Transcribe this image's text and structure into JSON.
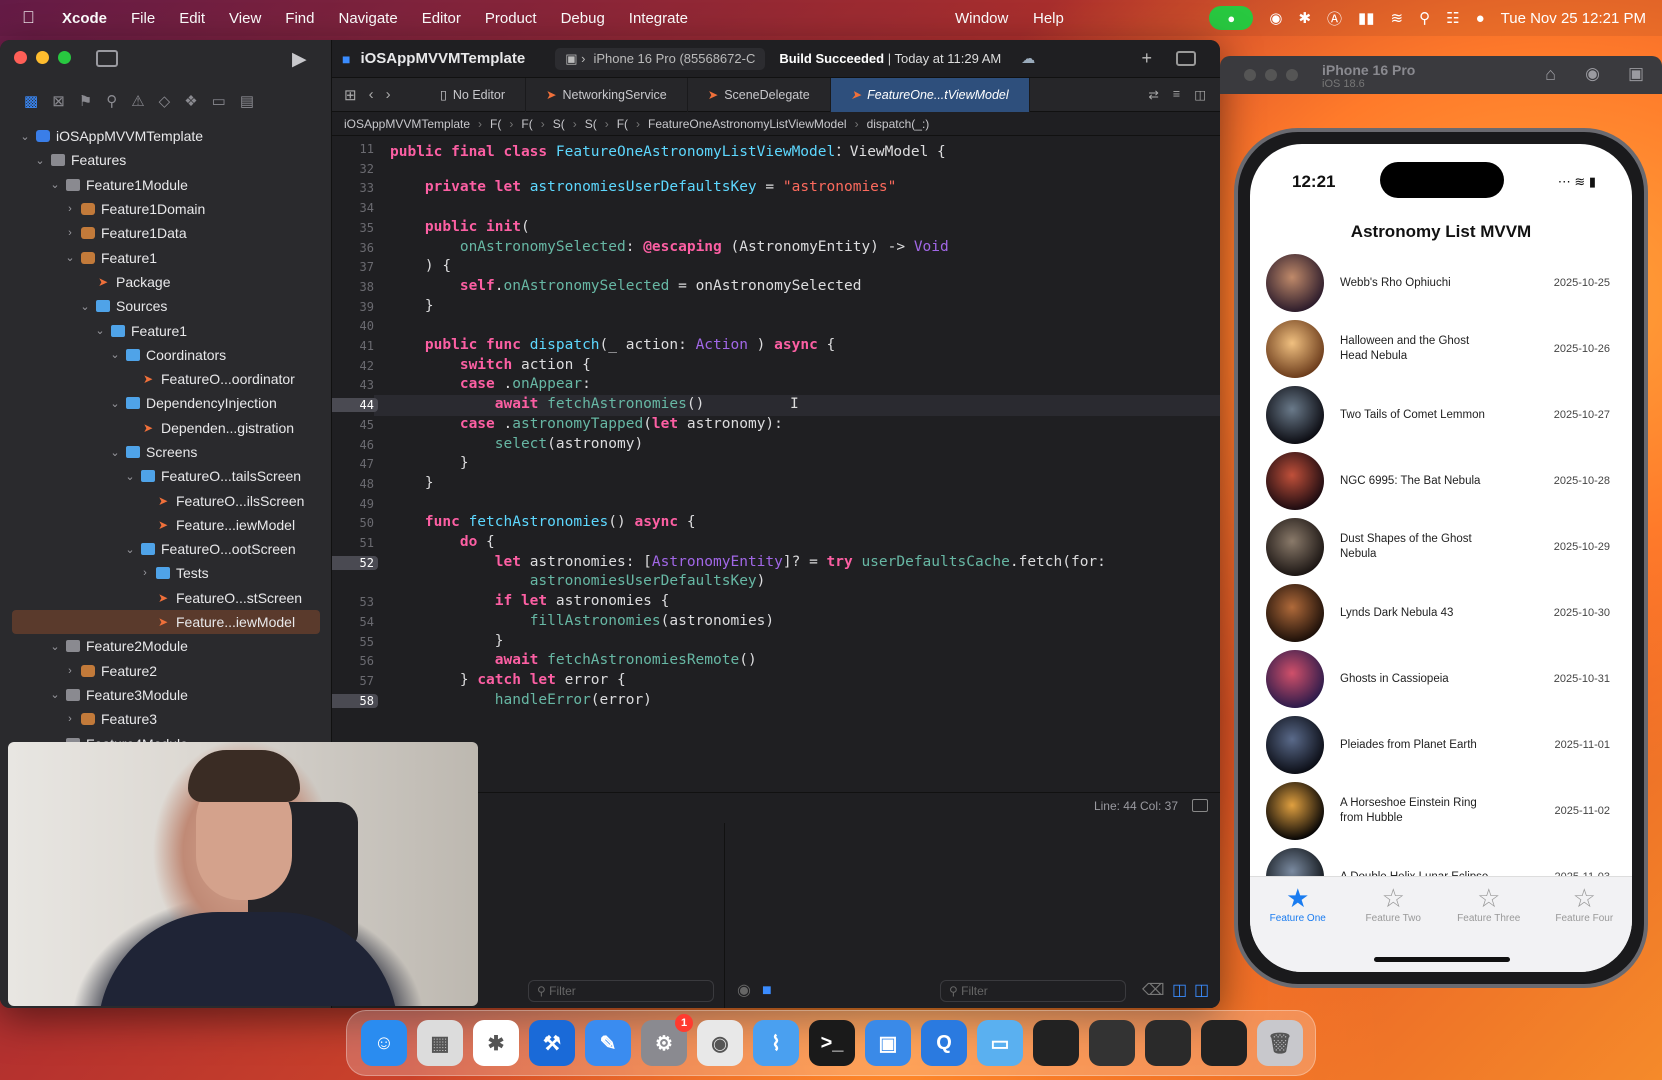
{
  "menubar": {
    "app": "Xcode",
    "items": [
      "File",
      "Edit",
      "View",
      "Find",
      "Navigate",
      "Editor",
      "Product",
      "Debug",
      "Integrate"
    ],
    "right_items": [
      "Window",
      "Help"
    ],
    "clock": "Tue Nov 25  12:21 PM"
  },
  "xcode": {
    "project": "iOSAppMVVMTemplate",
    "scheme_device": "iPhone 16 Pro (85568672-C",
    "build_status_bold": "Build Succeeded",
    "build_status_rest": "| Today at 11:29 AM",
    "tabs": [
      "No Editor",
      "NetworkingService",
      "SceneDelegate",
      "FeatureOne...tViewModel"
    ],
    "breadcrumb": [
      "iOSAppMVVMTemplate",
      "F(",
      "F(",
      "S(",
      "S(",
      "F(",
      "FeatureOneAstronomyListViewModel",
      "dispatch(_:)"
    ],
    "sticky_line": "11",
    "cursor_status": "Line: 44  Col: 37",
    "filter_placeholder": "Filter"
  },
  "navigator": {
    "rows": [
      {
        "label": "iOSAppMVVMTemplate",
        "indent": 0,
        "chev": "v",
        "icon": "proj"
      },
      {
        "label": "Features",
        "indent": 1,
        "chev": "v",
        "icon": "gfolder"
      },
      {
        "label": "Feature1Module",
        "indent": 2,
        "chev": "v",
        "icon": "gfolder"
      },
      {
        "label": "Feature1Domain",
        "indent": 3,
        "chev": ">",
        "icon": "pkg"
      },
      {
        "label": "Feature1Data",
        "indent": 3,
        "chev": ">",
        "icon": "pkg"
      },
      {
        "label": "Feature1",
        "indent": 3,
        "chev": "v",
        "icon": "pkg"
      },
      {
        "label": "Package",
        "indent": 4,
        "chev": "",
        "icon": "swift"
      },
      {
        "label": "Sources",
        "indent": 4,
        "chev": "v",
        "icon": "folder"
      },
      {
        "label": "Feature1",
        "indent": 5,
        "chev": "v",
        "icon": "folder"
      },
      {
        "label": "Coordinators",
        "indent": 6,
        "chev": "v",
        "icon": "folder"
      },
      {
        "label": "FeatureO...oordinator",
        "indent": 7,
        "chev": "",
        "icon": "swift"
      },
      {
        "label": "DependencyInjection",
        "indent": 6,
        "chev": "v",
        "icon": "folder"
      },
      {
        "label": "Dependen...gistration",
        "indent": 7,
        "chev": "",
        "icon": "swift"
      },
      {
        "label": "Screens",
        "indent": 6,
        "chev": "v",
        "icon": "folder"
      },
      {
        "label": "FeatureO...tailsScreen",
        "indent": 7,
        "chev": "v",
        "icon": "folder"
      },
      {
        "label": "FeatureO...ilsScreen",
        "indent": 8,
        "chev": "",
        "icon": "swift"
      },
      {
        "label": "Feature...iewModel",
        "indent": 8,
        "chev": "",
        "icon": "swift"
      },
      {
        "label": "FeatureO...ootScreen",
        "indent": 7,
        "chev": "v",
        "icon": "folder"
      },
      {
        "label": "Tests",
        "indent": 8,
        "chev": ">",
        "icon": "folder"
      },
      {
        "label": "FeatureO...stScreen",
        "indent": 8,
        "chev": "",
        "icon": "swift"
      },
      {
        "label": "Feature...iewModel",
        "indent": 8,
        "chev": "",
        "icon": "swift",
        "selected": true
      },
      {
        "label": "Feature2Module",
        "indent": 2,
        "chev": "v",
        "icon": "gfolder"
      },
      {
        "label": "Feature2",
        "indent": 3,
        "chev": ">",
        "icon": "pkg"
      },
      {
        "label": "Feature3Module",
        "indent": 2,
        "chev": "v",
        "icon": "gfolder"
      },
      {
        "label": "Feature3",
        "indent": 3,
        "chev": ">",
        "icon": "pkg"
      },
      {
        "label": "Feature4Module",
        "indent": 2,
        "chev": "v",
        "icon": "gfolder"
      }
    ]
  },
  "code": {
    "lines": [
      {
        "n": "11",
        "t": [
          [
            "kw",
            "public final class "
          ],
          [
            "ty",
            "FeatureOneAstronomyListViewModel"
          ],
          [
            "",
            "：ViewModel {"
          ]
        ]
      },
      {
        "n": "32",
        "t": []
      },
      {
        "n": "33",
        "t": [
          [
            "",
            "    "
          ],
          [
            "kw",
            "private let "
          ],
          [
            "ty",
            "astronomiesUserDefaultsKey"
          ],
          [
            "",
            " = "
          ],
          [
            "st",
            "\"astronomies\""
          ]
        ]
      },
      {
        "n": "34",
        "t": []
      },
      {
        "n": "35",
        "t": [
          [
            "",
            "    "
          ],
          [
            "kw",
            "public init"
          ],
          [
            "",
            "("
          ]
        ]
      },
      {
        "n": "36",
        "t": [
          [
            "",
            "        "
          ],
          [
            "fn",
            "onAstronomySelected"
          ],
          [
            "",
            ": "
          ],
          [
            "kw",
            "@escaping"
          ],
          [
            "",
            " (AstronomyEntity) -> "
          ],
          [
            "pl",
            "Void"
          ]
        ]
      },
      {
        "n": "37",
        "t": [
          [
            "",
            "    ) {"
          ]
        ]
      },
      {
        "n": "38",
        "t": [
          [
            "",
            "        "
          ],
          [
            "kw",
            "self"
          ],
          [
            "",
            "."
          ],
          [
            "fn",
            "onAstronomySelected"
          ],
          [
            "",
            " = onAstronomySelected"
          ]
        ]
      },
      {
        "n": "39",
        "t": [
          [
            "",
            "    }"
          ]
        ]
      },
      {
        "n": "40",
        "t": []
      },
      {
        "n": "41",
        "t": [
          [
            "",
            "    "
          ],
          [
            "kw",
            "public func "
          ],
          [
            "ty",
            "dispatch"
          ],
          [
            "",
            "(_ action: "
          ],
          [
            "pl",
            "Action"
          ],
          [
            "",
            " ) "
          ],
          [
            "kw",
            "async"
          ],
          [
            "",
            " {"
          ]
        ]
      },
      {
        "n": "42",
        "t": [
          [
            "",
            "        "
          ],
          [
            "kw",
            "switch"
          ],
          [
            "",
            " action {"
          ]
        ]
      },
      {
        "n": "43",
        "t": [
          [
            "",
            "        "
          ],
          [
            "kw",
            "case"
          ],
          [
            "",
            " ."
          ],
          [
            "fn",
            "onAppear"
          ],
          [
            "",
            ":"
          ]
        ]
      },
      {
        "n": "44",
        "t": [
          [
            "",
            "            "
          ],
          [
            "kw",
            "await "
          ],
          [
            "fn",
            "fetchAstronomies"
          ],
          [
            "",
            "()"
          ]
        ],
        "bp": true,
        "hl": true
      },
      {
        "n": "45",
        "t": [
          [
            "",
            "        "
          ],
          [
            "kw",
            "case"
          ],
          [
            "",
            " ."
          ],
          [
            "fn",
            "astronomyTapped"
          ],
          [
            "",
            "("
          ],
          [
            "kw",
            "let"
          ],
          [
            "",
            " astronomy):"
          ]
        ]
      },
      {
        "n": "46",
        "t": [
          [
            "",
            "            "
          ],
          [
            "fn",
            "select"
          ],
          [
            "",
            "(astronomy)"
          ]
        ]
      },
      {
        "n": "47",
        "t": [
          [
            "",
            "        }"
          ]
        ]
      },
      {
        "n": "48",
        "t": [
          [
            "",
            "    }"
          ]
        ]
      },
      {
        "n": "49",
        "t": []
      },
      {
        "n": "50",
        "t": [
          [
            "",
            "    "
          ],
          [
            "kw",
            "func "
          ],
          [
            "ty",
            "fetchAstronomies"
          ],
          [
            "",
            "() "
          ],
          [
            "kw",
            "async"
          ],
          [
            "",
            " {"
          ]
        ]
      },
      {
        "n": "51",
        "t": [
          [
            "",
            "        "
          ],
          [
            "kw",
            "do"
          ],
          [
            "",
            " {"
          ]
        ]
      },
      {
        "n": "52",
        "t": [
          [
            "",
            "            "
          ],
          [
            "kw",
            "let"
          ],
          [
            "",
            " astronomies: ["
          ],
          [
            "pl",
            "AstronomyEntity"
          ],
          [
            "",
            "]? = "
          ],
          [
            "kw",
            "try "
          ],
          [
            "fn",
            "userDefaultsCache"
          ],
          [
            "",
            ".fetch(for:"
          ]
        ],
        "bp": true
      },
      {
        "n": "",
        "t": [
          [
            "",
            "                "
          ],
          [
            "fn",
            "astronomiesUserDefaultsKey"
          ],
          [
            "",
            ")"
          ]
        ]
      },
      {
        "n": "53",
        "t": [
          [
            "",
            "            "
          ],
          [
            "kw",
            "if let"
          ],
          [
            "",
            " astronomies {"
          ]
        ]
      },
      {
        "n": "54",
        "t": [
          [
            "",
            "                "
          ],
          [
            "fn",
            "fillAstronomies"
          ],
          [
            "",
            "(astronomies)"
          ]
        ]
      },
      {
        "n": "55",
        "t": [
          [
            "",
            "            }"
          ]
        ]
      },
      {
        "n": "56",
        "t": [
          [
            "",
            "            "
          ],
          [
            "kw",
            "await "
          ],
          [
            "fn",
            "fetchAstronomiesRemote"
          ],
          [
            "",
            "()"
          ]
        ]
      },
      {
        "n": "57",
        "t": [
          [
            "",
            "        } "
          ],
          [
            "kw",
            "catch let"
          ],
          [
            "",
            " error {"
          ]
        ]
      },
      {
        "n": "58",
        "t": [
          [
            "",
            "            "
          ],
          [
            "fn",
            "handleError"
          ],
          [
            "",
            "(error)"
          ]
        ],
        "bp": true
      }
    ]
  },
  "simulator": {
    "device": "iPhone 16 Pro",
    "os": "iOS 18.6",
    "time": "12:21",
    "title": "Astronomy List MVVM",
    "items": [
      {
        "title": "Webb's Rho Ophiuchi",
        "date": "2025-10-25",
        "c1": "#c08a6a",
        "c2": "#2a1a2a"
      },
      {
        "title": "Halloween and the Ghost Head Nebula",
        "date": "2025-10-26",
        "c1": "#f0c080",
        "c2": "#6a3a1a"
      },
      {
        "title": "Two Tails of Comet Lemmon",
        "date": "2025-10-27",
        "c1": "#6a7a8a",
        "c2": "#0a0a10"
      },
      {
        "title": "NGC 6995: The Bat Nebula",
        "date": "2025-10-28",
        "c1": "#c0503a",
        "c2": "#1a0a10"
      },
      {
        "title": "Dust Shapes of the Ghost Nebula",
        "date": "2025-10-29",
        "c1": "#8a7a6a",
        "c2": "#1a1412"
      },
      {
        "title": "Lynds Dark Nebula 43",
        "date": "2025-10-30",
        "c1": "#b06a3a",
        "c2": "#1a0e08"
      },
      {
        "title": "Ghosts in Cassiopeia",
        "date": "2025-10-31",
        "c1": "#d0506a",
        "c2": "#2a1a4a"
      },
      {
        "title": "Pleiades from Planet Earth",
        "date": "2025-11-01",
        "c1": "#5a6a8a",
        "c2": "#0a0c14"
      },
      {
        "title": "A Horseshoe Einstein Ring from Hubble",
        "date": "2025-11-02",
        "c1": "#e0a040",
        "c2": "#020204"
      },
      {
        "title": "A Double Helix Lunar Eclipse",
        "date": "2025-11-03",
        "c1": "#7a8aa0",
        "c2": "#101418"
      }
    ],
    "tabs": [
      "Feature One",
      "Feature Two",
      "Feature Three",
      "Feature Four"
    ]
  },
  "dock": {
    "apps": [
      {
        "name": "Finder",
        "color": "#2a8cf0",
        "glyph": "☺"
      },
      {
        "name": "Launchpad",
        "color": "#dcdcdc",
        "glyph": "▦"
      },
      {
        "name": "Slack",
        "color": "#ffffff",
        "glyph": "✱"
      },
      {
        "name": "Xcode",
        "color": "#1a6ad8",
        "glyph": "⚒"
      },
      {
        "name": "Instruments",
        "color": "#3a8cf0",
        "glyph": "✎"
      },
      {
        "name": "System Settings",
        "color": "#8a8a90",
        "glyph": "⚙",
        "badge": "1"
      },
      {
        "name": "Chrome",
        "color": "#e8e8e8",
        "glyph": "◉"
      },
      {
        "name": "Xcode Cloud",
        "color": "#4aa0f0",
        "glyph": "⌇"
      },
      {
        "name": "Terminal",
        "color": "#1a1a1a",
        "glyph": ">_"
      },
      {
        "name": "Simulator",
        "color": "#3a8ae8",
        "glyph": "▣"
      },
      {
        "name": "QuickTime",
        "color": "#2a7ae0",
        "glyph": "Q"
      },
      {
        "name": "Downloads",
        "color": "#5ab0f0",
        "glyph": "▭"
      },
      {
        "name": "Window 1",
        "color": "#222",
        "glyph": ""
      },
      {
        "name": "Window 2",
        "color": "#333",
        "glyph": ""
      },
      {
        "name": "Window 3",
        "color": "#2a2a2a",
        "glyph": ""
      },
      {
        "name": "Window 4",
        "color": "#222",
        "glyph": ""
      },
      {
        "name": "Trash",
        "color": "#c8c8cc",
        "glyph": "🗑"
      }
    ]
  }
}
